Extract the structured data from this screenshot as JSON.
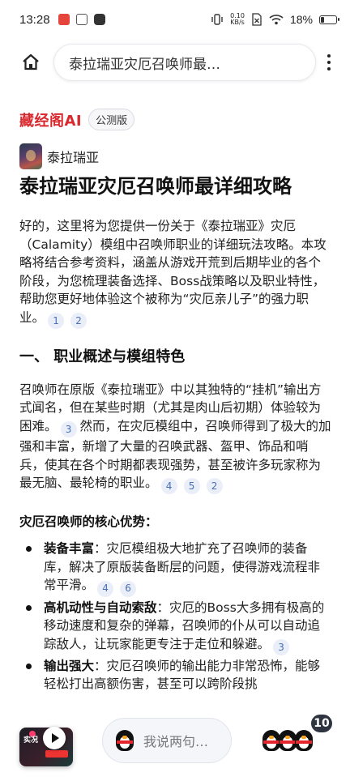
{
  "status_bar": {
    "time": "13:28",
    "net_speed_value": "0.10",
    "net_speed_unit": "KB/s",
    "battery": "18%",
    "battery_level": 0.18,
    "icons": [
      "app-notification-icon",
      "app-notification-icon",
      "app-notification-icon",
      "vibrate-icon",
      "sim-off-icon",
      "wifi-icon",
      "battery-icon"
    ]
  },
  "top_bar": {
    "url_title": "泰拉瑞亚灾厄召唤师最…",
    "icons": [
      "home-icon",
      "more-vertical-icon"
    ]
  },
  "brand": {
    "name": "藏经阁AI",
    "tag": "公测版",
    "color": "#d8282e"
  },
  "author": {
    "name": "泰拉瑞亚"
  },
  "article": {
    "title": "泰拉瑞亚灾厄召唤师最详细攻略",
    "intro": "好的，这里将为您提供一份关于《泰拉瑞亚》灾厄（Calamity）模组中召唤师职业的详细玩法攻略。本攻略将结合参考资料，涵盖从游戏开荒到后期毕业的各个阶段，为您梳理装备选择、Boss战策略以及职业特性，帮助您更好地体验这个被称为“灾厄亲儿子”的强力职业。",
    "intro_cites": [
      "1",
      "2"
    ],
    "section1_heading": "一、 职业概述与模组特色",
    "section1_p1": "召唤师在原版《泰拉瑞亚》中以其独特的“挂机”输出方式闻名，但在某些时期（尤其是肉山后初期）体验较为困难。",
    "section1_p1_cite": "3",
    "section1_p1_cont": "然而，在灾厄模组中，召唤师得到了极大的加强和丰富，新增了大量的召唤武器、盔甲、饰品和哨兵，使其在各个时期都表现强势，甚至被许多玩家称为最无脑、最轮椅的职业。",
    "section1_p1_cites": [
      "4",
      "5",
      "2"
    ],
    "advantages_heading": "灾厄召唤师的核心优势：",
    "advantages": [
      {
        "title": "装备丰富",
        "text": "：灾厄模组极大地扩充了召唤师的装备库，解决了原版装备断层的问题，使得游戏流程非常平滑。",
        "cites": [
          "4",
          "6"
        ]
      },
      {
        "title": "高机动性与自动索敌",
        "text": "：灾厄的Boss大多拥有极高的移动速度和复杂的弹幕，召唤师的仆从可以自动追踪敌人，让玩家能更专注于走位和躲避。",
        "cites": [
          "3"
        ]
      },
      {
        "title": "输出强大",
        "text": "：灾厄召唤师的输出能力非常恐怖，能够轻松打出高额伤害，甚至可以跨阶段挑",
        "cites": []
      }
    ]
  },
  "bottom_bar": {
    "video_thumb_text": "实况",
    "chat_placeholder": "我说两句…",
    "comment_count": "10",
    "icons": [
      "play-icon",
      "penguin-mascot-icon"
    ]
  }
}
